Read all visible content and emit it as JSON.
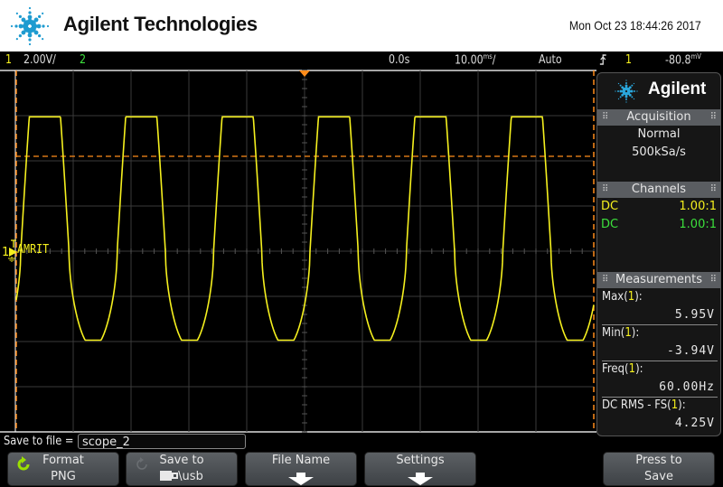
{
  "header": {
    "brand": "Agilent Technologies",
    "timestamp": "Mon Oct 23 18:44:26 2017"
  },
  "status_bar": {
    "ch1_num": "1",
    "ch1_scale": "2.00V/",
    "ch2_num": "2",
    "time_offset": "0.0s",
    "time_scale_value": "10.00",
    "time_scale_unit": "ms",
    "time_scale_suffix": "/",
    "trigger_mode": "Auto",
    "trigger_slope_icon": "rising-edge-icon",
    "trigger_source": "1",
    "trigger_level_value": "-80.8",
    "trigger_level_unit": "mV"
  },
  "scope": {
    "channel_marker": "1",
    "channel_label": "AMRIT",
    "colors": {
      "ch1": "#f5f01e",
      "ch2": "#3ce03c",
      "trigger": "#ff8c1a",
      "grid": "#3a3a3a"
    },
    "grid": {
      "h_divisions": 10,
      "v_divisions": 8
    },
    "waveform": {
      "volts_per_div": 2.0,
      "ms_per_div": 10.0,
      "frequency_hz": 60.0,
      "max_v": 5.95,
      "min_v": -3.94
    }
  },
  "panel": {
    "brand": "Agilent",
    "acquisition": {
      "title": "Acquisition",
      "mode": "Normal",
      "rate": "500kSa/s"
    },
    "channels": {
      "title": "Channels",
      "rows": [
        {
          "coupling": "DC",
          "probe": "1.00:1",
          "color": "yellow"
        },
        {
          "coupling": "DC",
          "probe": "1.00:1",
          "color": "green"
        }
      ]
    },
    "measurements": {
      "title": "Measurements",
      "items": [
        {
          "label_pre": "Max(",
          "src": "1",
          "label_post": "):",
          "value": "5.95V"
        },
        {
          "label_pre": "Min(",
          "src": "1",
          "label_post": "):",
          "value": "-3.94V"
        },
        {
          "label_pre": "Freq(",
          "src": "1",
          "label_post": "):",
          "value": "60.00Hz"
        },
        {
          "label_pre": "DC RMS - FS(",
          "src": "1",
          "label_post": "):",
          "value": "4.25V"
        }
      ]
    }
  },
  "save": {
    "label": "Save to file =",
    "filename": "scope_2"
  },
  "softkeys": [
    {
      "line1": "Format",
      "line2": "PNG",
      "icon": "rotate-icon"
    },
    {
      "line1": "Save to",
      "line2": "\\usb",
      "icon": "usb-drive-icon"
    },
    {
      "line1": "File Name",
      "icon": "arrow-down-icon"
    },
    {
      "line1": "Settings",
      "icon": "arrow-down-icon"
    },
    {
      "line1": "Press to",
      "line2": "Save"
    }
  ]
}
